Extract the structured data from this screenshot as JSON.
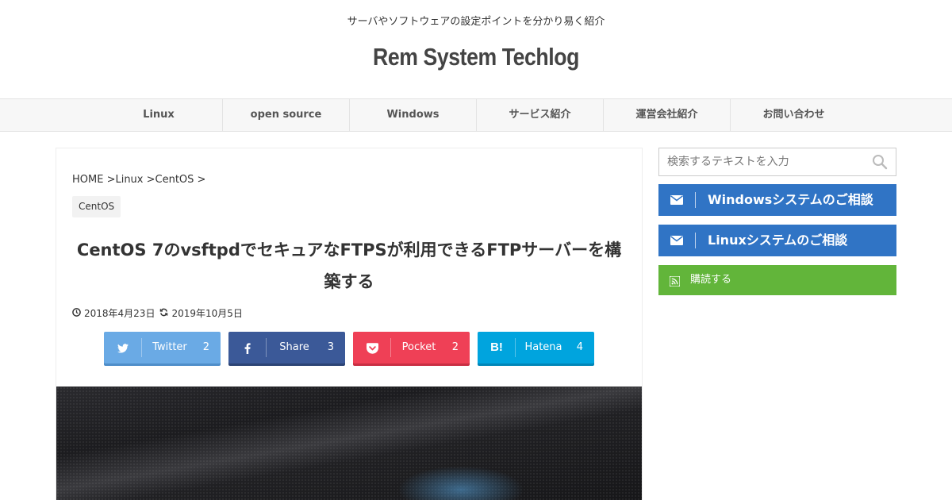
{
  "header": {
    "tagline": "サーバやソフトウェアの設定ポイントを分かり易く紹介",
    "site_title": "Rem System Techlog"
  },
  "nav": {
    "items": [
      {
        "label": "Linux"
      },
      {
        "label": "open source"
      },
      {
        "label": "Windows"
      },
      {
        "label": "サービス紹介"
      },
      {
        "label": "運営会社紹介"
      },
      {
        "label": "お問い合わせ"
      }
    ]
  },
  "article": {
    "breadcrumb": "HOME >Linux >CentOS >",
    "category": "CentOS",
    "title": "CentOS 7のvsftpdでセキュアなFTPSが利用できるFTPサーバーを構築する",
    "published": "2018年4月23日",
    "updated": "2019年10月5日"
  },
  "share": {
    "buttons": [
      {
        "label": "Twitter",
        "count": "2",
        "color": "#6aaae5",
        "icon": "twitter-icon"
      },
      {
        "label": "Share",
        "count": "3",
        "color": "#3b5998",
        "icon": "facebook-icon"
      },
      {
        "label": "Pocket",
        "count": "2",
        "color": "#ef4056",
        "icon": "pocket-icon"
      },
      {
        "label": "Hatena",
        "count": "4",
        "color": "#00a4de",
        "icon": "hatena-icon"
      }
    ]
  },
  "sidebar": {
    "search_placeholder": "検索するテキストを入力",
    "consult_windows": "Windowsシステムのご相談",
    "consult_linux": "Linuxシステムのご相談",
    "subscribe": "購読する",
    "colors": {
      "consult": "#3074c5",
      "subscribe": "#62b53a"
    }
  }
}
